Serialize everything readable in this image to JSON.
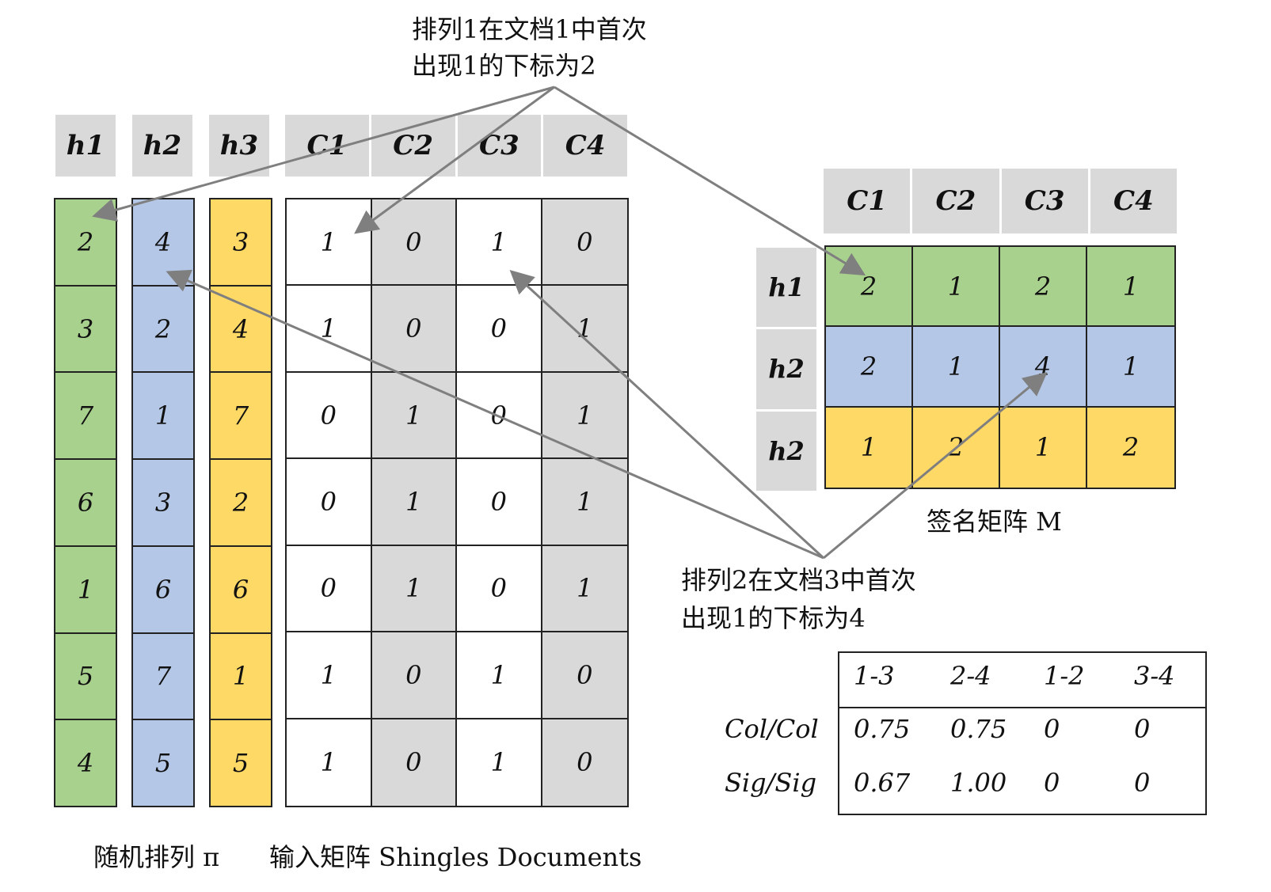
{
  "headers": {
    "hash": [
      "h1",
      "h2",
      "h3"
    ],
    "docs": [
      "C1",
      "C2",
      "C3",
      "C4"
    ]
  },
  "permutations": {
    "h1": [
      "2",
      "3",
      "7",
      "6",
      "1",
      "5",
      "4"
    ],
    "h2": [
      "4",
      "2",
      "1",
      "3",
      "6",
      "7",
      "5"
    ],
    "h3": [
      "3",
      "4",
      "7",
      "2",
      "6",
      "1",
      "5"
    ]
  },
  "input_matrix": [
    [
      "1",
      "0",
      "1",
      "0"
    ],
    [
      "1",
      "0",
      "0",
      "1"
    ],
    [
      "0",
      "1",
      "0",
      "1"
    ],
    [
      "0",
      "1",
      "0",
      "1"
    ],
    [
      "0",
      "1",
      "0",
      "1"
    ],
    [
      "1",
      "0",
      "1",
      "0"
    ],
    [
      "1",
      "0",
      "1",
      "0"
    ]
  ],
  "signature": {
    "col_headers": [
      "C1",
      "C2",
      "C3",
      "C4"
    ],
    "row_headers": [
      "h1",
      "h2",
      "h2"
    ],
    "rows": [
      [
        "2",
        "1",
        "2",
        "1"
      ],
      [
        "2",
        "1",
        "4",
        "1"
      ],
      [
        "1",
        "2",
        "1",
        "2"
      ]
    ],
    "caption": "签名矩阵 M"
  },
  "annotations": {
    "top_line1": "排列1在文档1中首次",
    "top_line2": "出现1的下标为2",
    "mid_line1": "排列2在文档3中首次",
    "mid_line2": "出现1的下标为4"
  },
  "captions": {
    "perm": "随机排列 π",
    "input": "输入矩阵 Shingles Documents"
  },
  "similarity": {
    "columns": [
      "1-3",
      "2-4",
      "1-2",
      "3-4"
    ],
    "rows": [
      {
        "label": "Col/Col",
        "values": [
          "0.75",
          "0.75",
          "0",
          "0"
        ]
      },
      {
        "label": "Sig/Sig",
        "values": [
          "0.67",
          "1.00",
          "0",
          "0"
        ]
      }
    ]
  },
  "colors": {
    "green": "#a9d18e",
    "blue": "#b4c7e7",
    "yellow": "#ffd966",
    "grey": "#d9d9d9",
    "arrow": "#7f7f7f"
  }
}
